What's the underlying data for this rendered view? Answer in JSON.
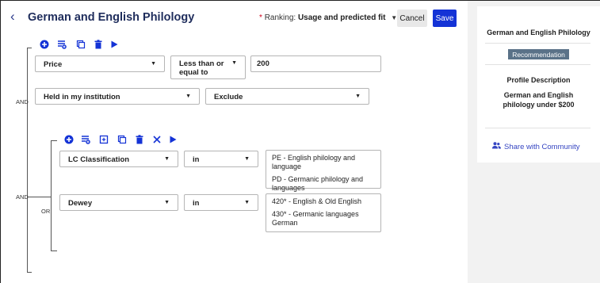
{
  "header": {
    "back_icon": "chevron-left-icon",
    "title": "German and English Philology",
    "ranking_required_mark": "*",
    "ranking_label": "Ranking:",
    "ranking_value": "Usage and predicted fit",
    "cancel_label": "Cancel",
    "save_label": "Save"
  },
  "outer_group": {
    "logic_ops": [
      "AND",
      "AND"
    ],
    "toolbar_icons": [
      "add-condition-icon",
      "add-group-icon",
      "duplicate-icon",
      "delete-icon",
      "run-icon"
    ],
    "conditions": [
      {
        "field": "Price",
        "operator": "Less than or equal to",
        "value": "200"
      },
      {
        "field": "Held in my institution",
        "operator": "Exclude"
      }
    ]
  },
  "inner_group": {
    "logic_op": "OR",
    "toolbar_icons": [
      "add-condition-icon",
      "add-group-icon",
      "collapse-icon",
      "duplicate-icon",
      "delete-icon",
      "close-icon",
      "run-icon"
    ],
    "conditions": [
      {
        "field": "LC Classification",
        "operator": "in",
        "values": [
          "PE - English philology and language",
          "PD - Germanic philology and languages"
        ]
      },
      {
        "field": "Dewey",
        "operator": "in",
        "values": [
          "420* - English & Old English",
          "430* - Germanic languages German"
        ]
      }
    ]
  },
  "side_panel": {
    "title": "German and English Philology",
    "badge": "Recommendation",
    "profile_heading": "Profile Description",
    "profile_description": "German and English philology under $200",
    "share_label": "Share with Community",
    "share_icon": "people-icon"
  },
  "colors": {
    "accent": "#1433d6",
    "title": "#1f2d5c",
    "badge": "#5a7288",
    "panel_bg": "#f2f2f2",
    "required": "#d0021b"
  }
}
